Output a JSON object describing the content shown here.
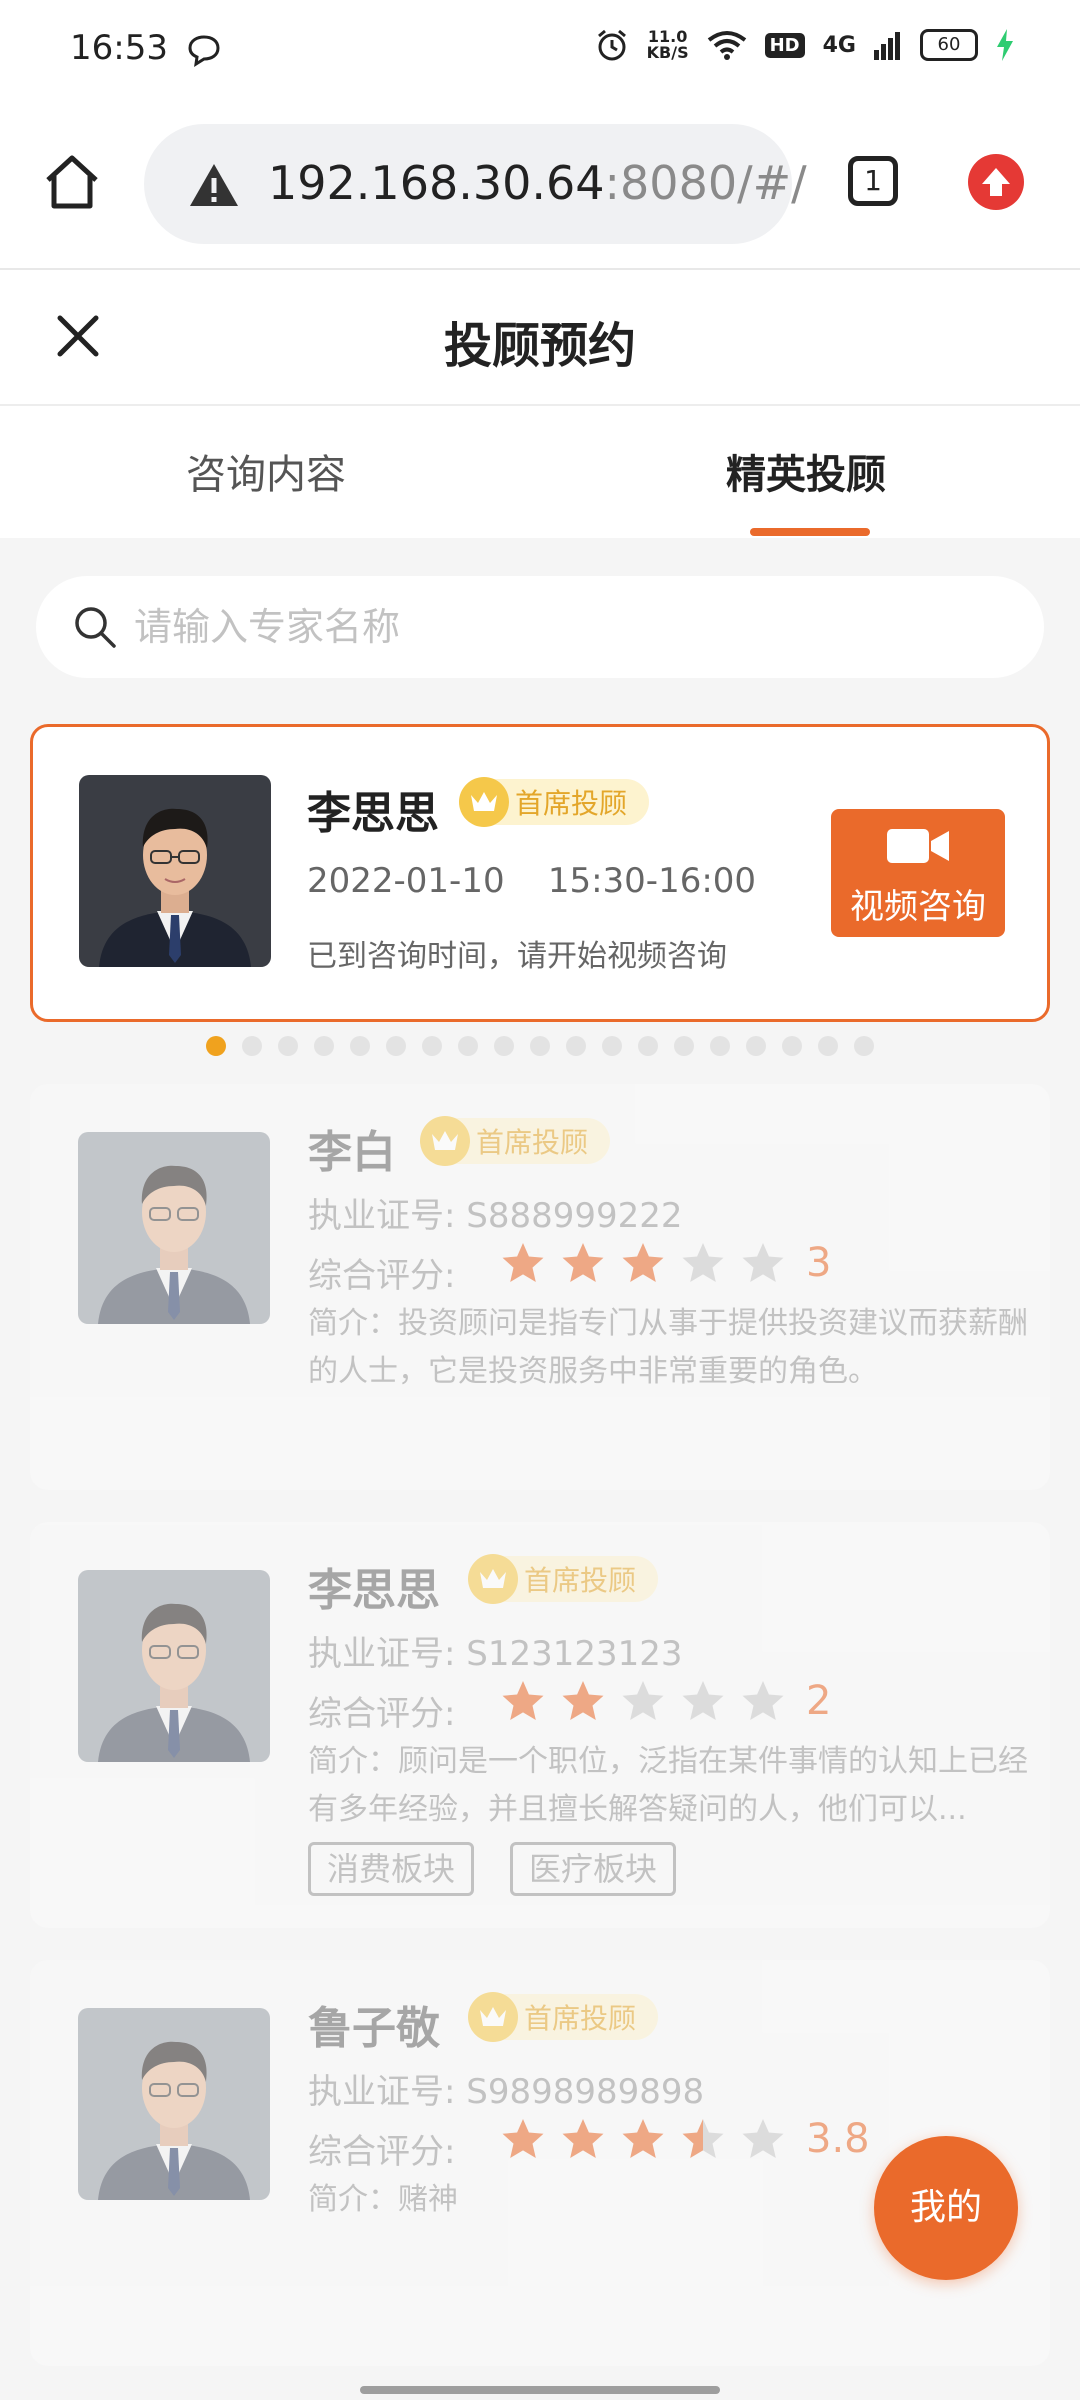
{
  "status_bar": {
    "time": "16:53",
    "net_speed_value": "11.0",
    "net_speed_unit": "KB/S",
    "hd": "HD",
    "network": "4G",
    "battery": "60"
  },
  "browser": {
    "url_host": "192.168.30.64",
    "url_rest": ":8080/#/",
    "tab_count": "1"
  },
  "header": {
    "title": "投顾预约"
  },
  "tabs": [
    {
      "label": "咨询内容"
    },
    {
      "label": "精英投顾",
      "active": true
    }
  ],
  "search": {
    "placeholder": "请输入专家名称"
  },
  "featured": {
    "name": "李思思",
    "badge": "首席投顾",
    "date": "2022-01-10",
    "time": "15:30-16:00",
    "note": "已到咨询时间，请开始视频咨询",
    "button": "视频咨询"
  },
  "pager": {
    "count": 19,
    "active_index": 0
  },
  "advisors": [
    {
      "name": "李白",
      "badge": "首席投顾",
      "license_label": "执业证号:",
      "license": "S888999222",
      "rating_label": "综合评分:",
      "rating": 3,
      "score": "3",
      "intro": "简介：投资顾问是指专门从事于提供投资建议而获薪酬的人士，它是投资服务中非常重要的角色。",
      "tags": []
    },
    {
      "name": "李思思",
      "badge": "首席投顾",
      "license_label": "执业证号:",
      "license": "S123123123",
      "rating_label": "综合评分:",
      "rating": 2,
      "score": "2",
      "intro": "简介：顾问是一个职位，泛指在某件事情的认知上已经有多年经验，并且擅长解答疑问的人，他们可以...",
      "tags": [
        "消费板块",
        "医疗板块"
      ]
    },
    {
      "name": "鲁子敬",
      "badge": "首席投顾",
      "license_label": "执业证号:",
      "license": "S9898989898",
      "rating_label": "综合评分:",
      "rating": 3.5,
      "score": "3.8",
      "intro": "简介：赌神",
      "tags": []
    }
  ],
  "fab": {
    "label": "我的"
  },
  "colors": {
    "accent": "#ea6a2b",
    "gold": "#f5c84a",
    "badge_bg": "#fdf3cf"
  }
}
